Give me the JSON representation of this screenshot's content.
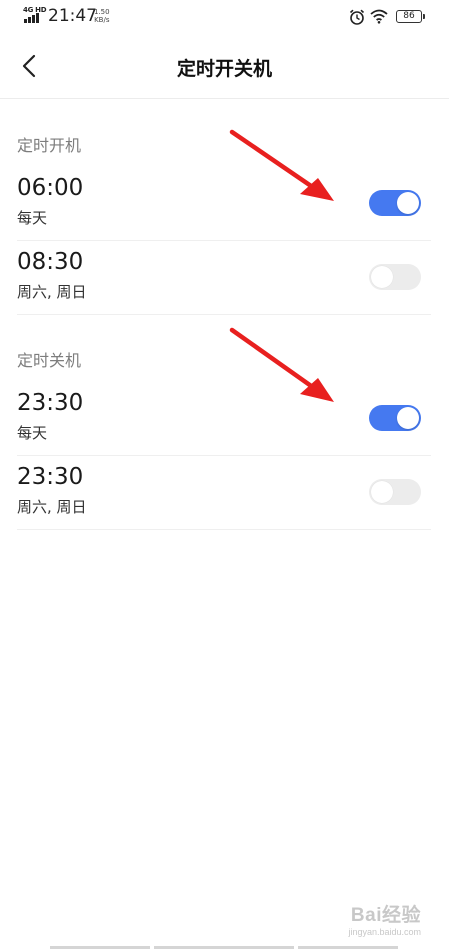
{
  "status_bar": {
    "network": "4G HD",
    "time": "21:47",
    "speed_value": "1.50",
    "speed_unit": "KB/s",
    "battery": "86"
  },
  "header": {
    "title": "定时开关机"
  },
  "sections": [
    {
      "title": "定时开机",
      "rows": [
        {
          "time": "06:00",
          "days": "每天",
          "enabled": true
        },
        {
          "time": "08:30",
          "days": "周六, 周日",
          "enabled": false
        }
      ]
    },
    {
      "title": "定时关机",
      "rows": [
        {
          "time": "23:30",
          "days": "每天",
          "enabled": true
        },
        {
          "time": "23:30",
          "days": "周六, 周日",
          "enabled": false
        }
      ]
    }
  ],
  "colors": {
    "toggle_on": "#4579f0",
    "toggle_off": "#ececec",
    "annotation_arrow": "#e8201f"
  },
  "watermark": {
    "brand": "Bai经验",
    "url": "jingyan.baidu.com"
  }
}
